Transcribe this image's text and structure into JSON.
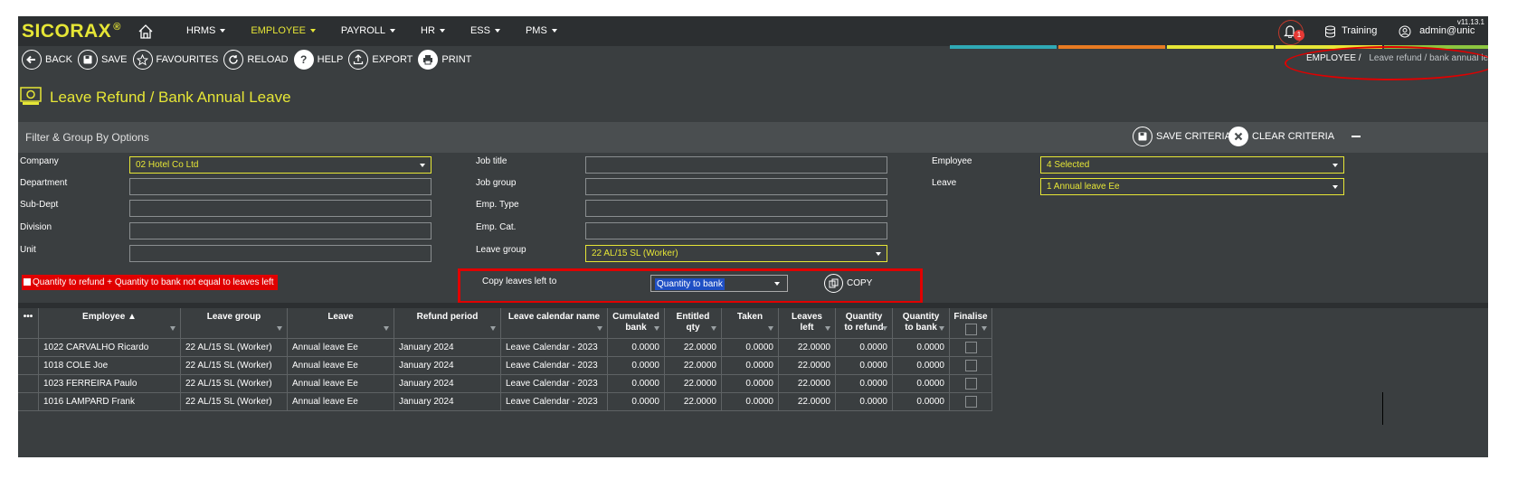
{
  "app": {
    "logo": "SICORAX",
    "logo_mark": "®",
    "version": "v11.13.1",
    "nav": [
      {
        "label": "HRMS",
        "active": false
      },
      {
        "label": "EMPLOYEE",
        "active": true
      },
      {
        "label": "PAYROLL",
        "active": false
      },
      {
        "label": "HR",
        "active": false
      },
      {
        "label": "ESS",
        "active": false
      },
      {
        "label": "PMS",
        "active": false
      }
    ],
    "notifications": "1",
    "training": "Training",
    "user": "admin@unic"
  },
  "toolbar": {
    "back": "BACK",
    "save": "SAVE",
    "favourites": "FAVOURITES",
    "reload": "RELOAD",
    "help": "HELP",
    "export": "EXPORT",
    "print": "PRINT"
  },
  "breadcrumb": {
    "root": "EMPLOYEE /",
    "current": "Leave refund / bank annual leave"
  },
  "page": {
    "title": "Leave Refund / Bank Annual Leave"
  },
  "filter": {
    "title": "Filter & Group By Options",
    "save_criteria": "SAVE CRITERIA",
    "clear_criteria": "CLEAR CRITERIA",
    "fields": {
      "company": {
        "label": "Company",
        "value": "02 Hotel Co Ltd"
      },
      "department": {
        "label": "Department",
        "value": ""
      },
      "sub_dept": {
        "label": "Sub-Dept",
        "value": ""
      },
      "division": {
        "label": "Division",
        "value": ""
      },
      "unit": {
        "label": "Unit",
        "value": ""
      },
      "job_title": {
        "label": "Job title",
        "value": ""
      },
      "job_group": {
        "label": "Job group",
        "value": ""
      },
      "emp_type": {
        "label": "Emp. Type",
        "value": ""
      },
      "emp_cat": {
        "label": "Emp. Cat.",
        "value": ""
      },
      "leave_group": {
        "label": "Leave group",
        "value": "22 AL/15 SL (Worker)"
      },
      "employee": {
        "label": "Employee",
        "value": "4 Selected"
      },
      "leave": {
        "label": "Leave",
        "value": "1 Annual leave Ee"
      }
    },
    "warning": "Quantity to refund + Quantity to bank not equal to leaves left",
    "copy_label": "Copy leaves left to",
    "copy_target": "Quantity to bank",
    "copy_button": "COPY"
  },
  "grid": {
    "menu": "•••",
    "columns": [
      {
        "l1": "Employee ▲",
        "l2": ""
      },
      {
        "l1": "Leave group",
        "l2": ""
      },
      {
        "l1": "Leave",
        "l2": ""
      },
      {
        "l1": "Refund period",
        "l2": ""
      },
      {
        "l1": "Leave calendar name",
        "l2": ""
      },
      {
        "l1": "Cumulated",
        "l2": "bank"
      },
      {
        "l1": "Entitled",
        "l2": "qty"
      },
      {
        "l1": "Taken",
        "l2": ""
      },
      {
        "l1": "Leaves",
        "l2": "left"
      },
      {
        "l1": "Quantity",
        "l2": "to refund"
      },
      {
        "l1": "Quantity",
        "l2": "to bank"
      },
      {
        "l1": "Finalise",
        "l2": ""
      }
    ],
    "rows": [
      [
        "1022 CARVALHO Ricardo",
        "22 AL/15 SL (Worker)",
        "Annual leave Ee",
        "January 2024",
        "Leave Calendar - 2023",
        "0.0000",
        "22.0000",
        "0.0000",
        "22.0000",
        "0.0000",
        "0.0000"
      ],
      [
        "1018 COLE Joe",
        "22 AL/15 SL (Worker)",
        "Annual leave Ee",
        "January 2024",
        "Leave Calendar - 2023",
        "0.0000",
        "22.0000",
        "0.0000",
        "22.0000",
        "0.0000",
        "0.0000"
      ],
      [
        "1023 FERREIRA Paulo",
        "22 AL/15 SL (Worker)",
        "Annual leave Ee",
        "January 2024",
        "Leave Calendar - 2023",
        "0.0000",
        "22.0000",
        "0.0000",
        "22.0000",
        "0.0000",
        "0.0000"
      ],
      [
        "1016 LAMPARD Frank",
        "22 AL/15 SL (Worker)",
        "Annual leave Ee",
        "January 2024",
        "Leave Calendar - 2023",
        "0.0000",
        "22.0000",
        "0.0000",
        "22.0000",
        "0.0000",
        "0.0000"
      ]
    ]
  },
  "colors": {
    "accent": "#e6e636",
    "panel": "#3a3e40",
    "alert": "#e00000"
  }
}
